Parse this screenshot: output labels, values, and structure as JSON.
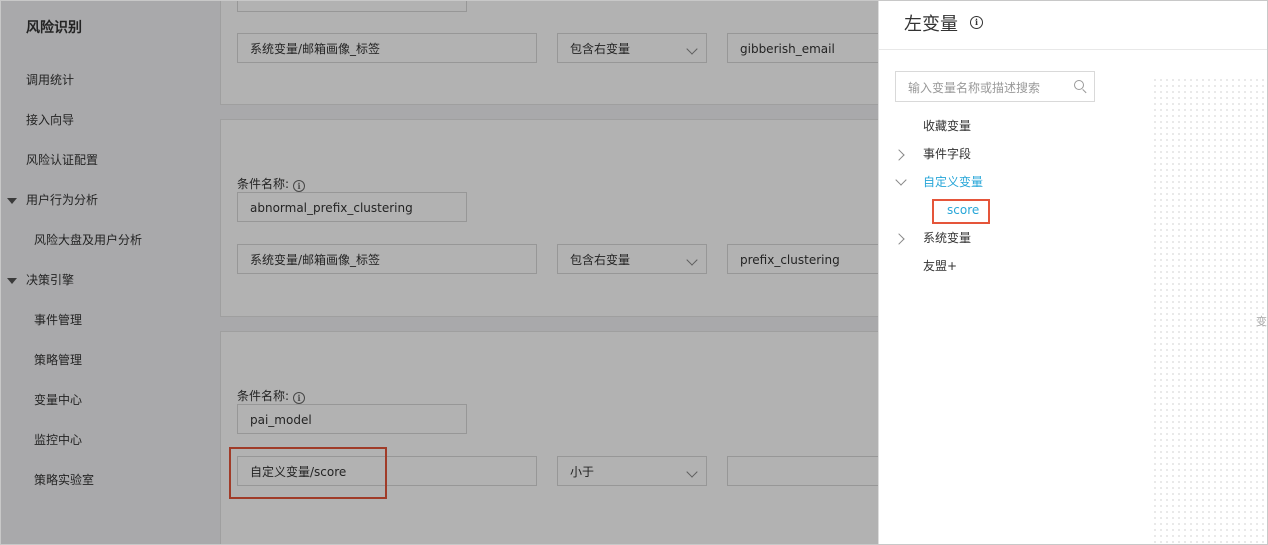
{
  "sidebar": {
    "brand": "风险识别",
    "items": [
      {
        "label": "调用统计"
      },
      {
        "label": "接入向导"
      },
      {
        "label": "风险认证配置"
      }
    ],
    "group_behavior": "用户行为分析",
    "behavior_children": [
      {
        "label": "风险大盘及用户分析"
      }
    ],
    "group_engine": "决策引擎",
    "engine_children": [
      {
        "label": "事件管理"
      },
      {
        "label": "策略管理"
      },
      {
        "label": "变量中心"
      },
      {
        "label": "监控中心"
      },
      {
        "label": "策略实验室"
      }
    ]
  },
  "main": {
    "card1": {
      "left_var": "系统变量/邮箱画像_标签",
      "operator": "包含右变量",
      "right_var": "gibberish_email"
    },
    "card2": {
      "condition_label": "条件名称:",
      "condition_name": "abnormal_prefix_clustering",
      "left_var": "系统变量/邮箱画像_标签",
      "operator": "包含右变量",
      "right_var": "prefix_clustering"
    },
    "card3": {
      "condition_label": "条件名称:",
      "condition_name": "pai_model",
      "left_var": "自定义变量/score",
      "operator": "小于",
      "right_var": ""
    }
  },
  "drawer": {
    "title": "左变量",
    "search_placeholder": "输入变量名称或描述搜索",
    "tree": {
      "favorites": "收藏变量",
      "event_fields": "事件字段",
      "custom_vars": "自定义变量",
      "custom_child": "score",
      "system_vars": "系统变量",
      "allies": "友盟+"
    },
    "edge_text": "变"
  },
  "colors": {
    "accent": "#27a6d8",
    "highlight": "#e5553a"
  }
}
